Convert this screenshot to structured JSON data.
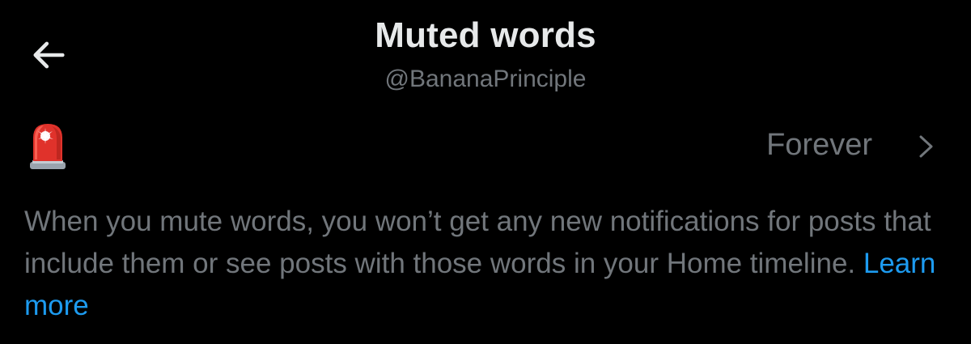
{
  "header": {
    "title": "Muted words",
    "handle": "@BananaPrinciple",
    "back_icon": "back-arrow-icon"
  },
  "muted_words": [
    {
      "emoji": "🚨",
      "emoji_icon": "police-light-icon",
      "duration": "Forever"
    }
  ],
  "description": {
    "text": "When you mute words, you won’t get any new notifications for posts that include them or see posts with those words in your Home timeline.",
    "link_text": "Learn more"
  },
  "colors": {
    "background": "#000000",
    "primary_text": "#e7e9ea",
    "secondary_text": "#71767b",
    "link": "#1d9bf0"
  }
}
